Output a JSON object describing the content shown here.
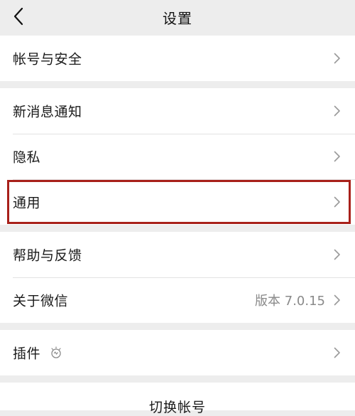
{
  "header": {
    "title": "设置",
    "back_icon": "chevron-left-icon"
  },
  "groups": [
    {
      "items": [
        {
          "label": "帐号与安全"
        }
      ]
    },
    {
      "items": [
        {
          "label": "新消息通知"
        },
        {
          "label": "隐私"
        },
        {
          "label": "通用",
          "highlighted": true
        }
      ]
    },
    {
      "items": [
        {
          "label": "帮助与反馈"
        },
        {
          "label": "关于微信",
          "value": "版本 7.0.15"
        }
      ]
    },
    {
      "items": [
        {
          "label": "插件",
          "icon": "bulb-icon"
        }
      ]
    }
  ],
  "footer": {
    "switch_account_label": "切换帐号"
  },
  "colors": {
    "background": "#ededed",
    "card": "#ffffff",
    "highlight_border": "#a8201a",
    "secondary_text": "#8a8a8a"
  }
}
